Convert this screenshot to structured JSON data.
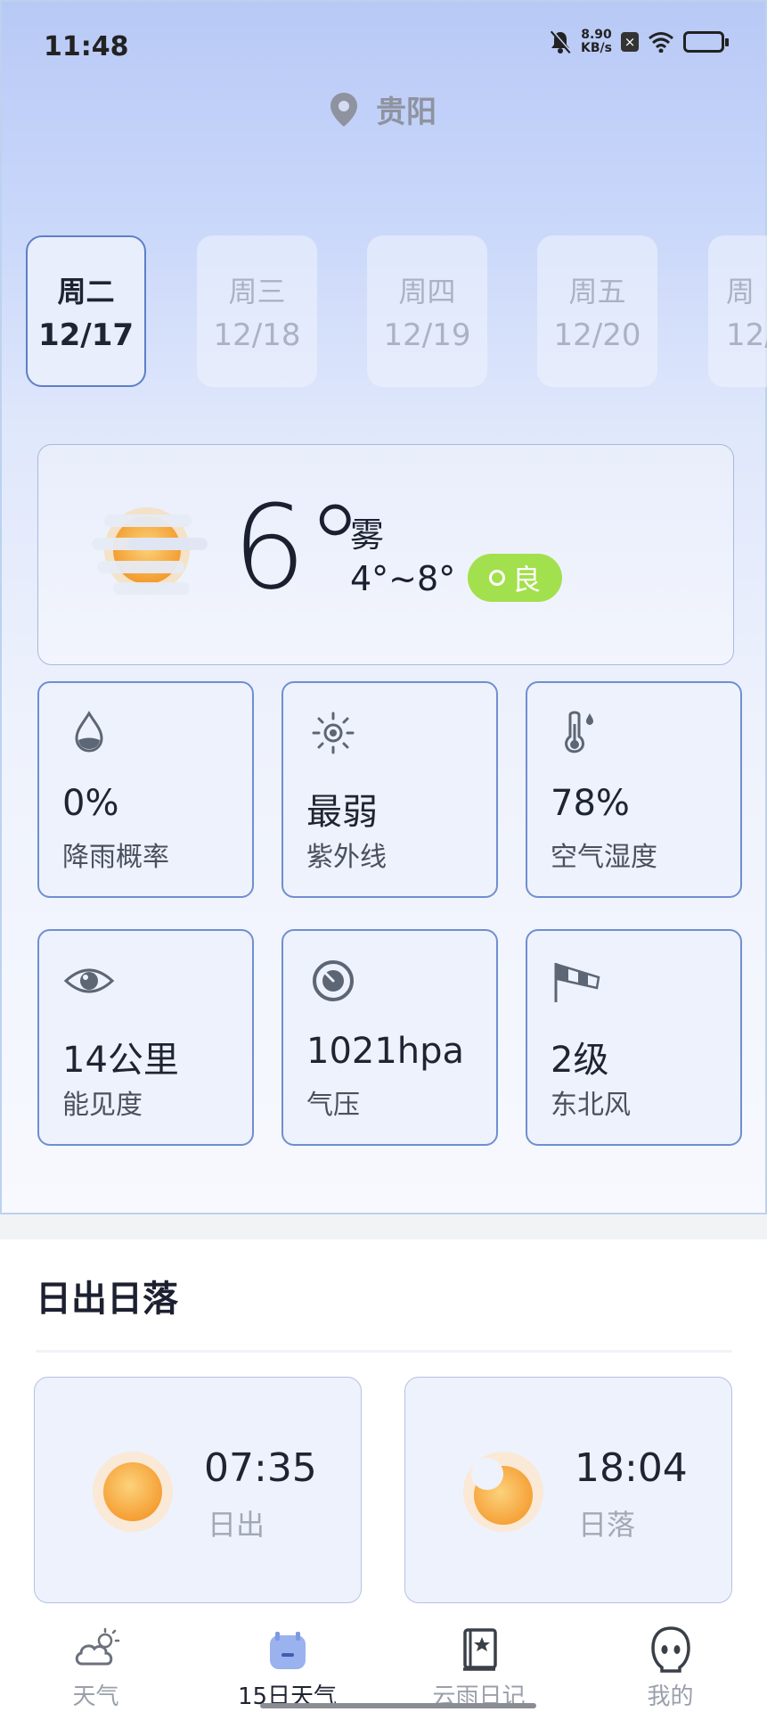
{
  "status_bar": {
    "time": "11:48",
    "speed_value": "8.90",
    "speed_unit": "KB/s"
  },
  "location": {
    "city": "贵阳"
  },
  "day_tabs": [
    {
      "dow": "周二",
      "date": "12/17",
      "active": true
    },
    {
      "dow": "周三",
      "date": "12/18"
    },
    {
      "dow": "周四",
      "date": "12/19"
    },
    {
      "dow": "周五",
      "date": "12/20"
    },
    {
      "dow": "周",
      "date": "12/"
    }
  ],
  "current": {
    "temperature": "6°",
    "condition": "雾",
    "range": "4°~8°",
    "aqi": "良",
    "aqi_color": "#a3e04d",
    "icon": "fog-sun-icon"
  },
  "metrics": [
    {
      "value": "0%",
      "label": "降雨概率",
      "icon": "raindrop-icon"
    },
    {
      "value": "最弱",
      "label": "紫外线",
      "icon": "sun-uv-icon"
    },
    {
      "value": "78%",
      "label": "空气湿度",
      "icon": "thermometer-icon"
    },
    {
      "value": "14公里",
      "label": "能见度",
      "icon": "eye-icon"
    },
    {
      "value": "1021hpa",
      "label": "气压",
      "icon": "gauge-icon"
    },
    {
      "value": "2级",
      "label": "东北风",
      "icon": "windsock-icon"
    }
  ],
  "sun_section": {
    "title": "日出日落",
    "sunrise": {
      "time": "07:35",
      "label": "日出"
    },
    "sunset": {
      "time": "18:04",
      "label": "日落"
    }
  },
  "bottom_nav": [
    {
      "label": "天气",
      "icon": "cloud-sun-icon"
    },
    {
      "label": "15日天气",
      "icon": "calendar-icon",
      "active": true
    },
    {
      "label": "云雨日记",
      "icon": "diary-book-icon"
    },
    {
      "label": "我的",
      "icon": "profile-face-icon"
    }
  ],
  "colors": {
    "accent": "#5d7fc9",
    "card_border": "#6f8fd0",
    "sun": "#f6a93b"
  }
}
